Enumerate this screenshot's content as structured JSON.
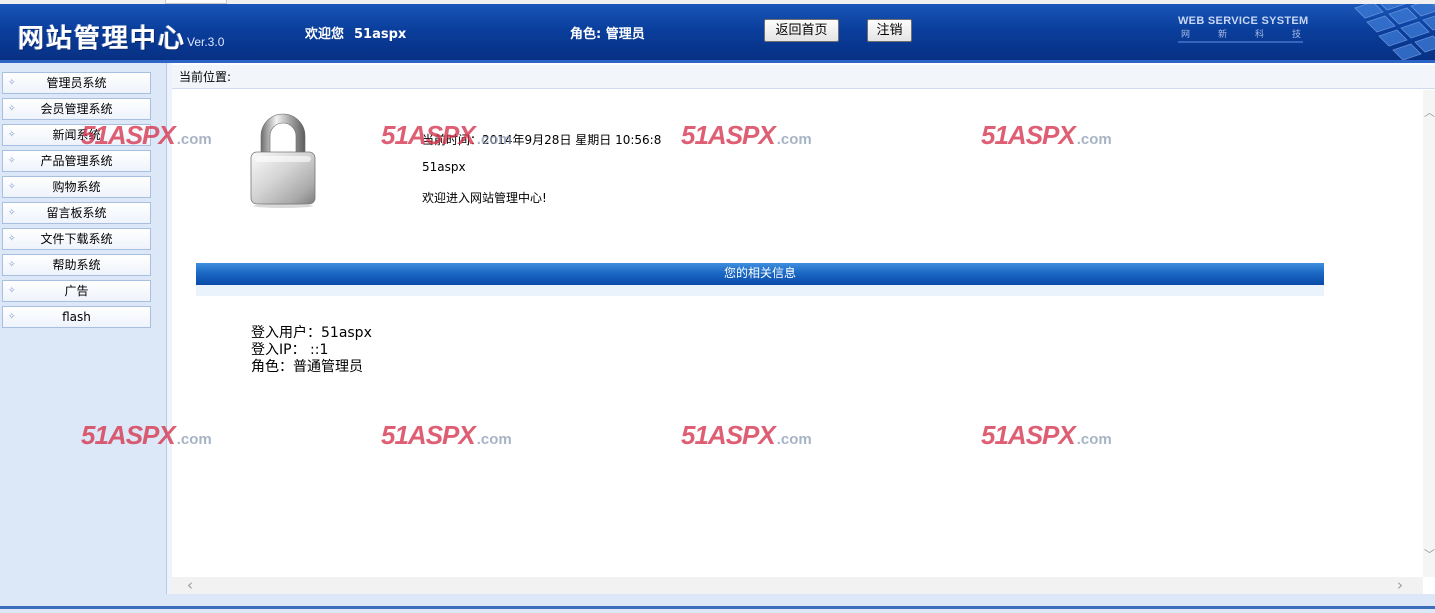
{
  "header": {
    "logo_text": "网站管理中心",
    "version": "Ver.3.0",
    "welcome_label": "欢迎您",
    "username": "51aspx",
    "role_label": "角色: 管理员",
    "home_button": "返回首页",
    "logout_button": "注销",
    "brand_en": "WEB SERVICE SYSTEM",
    "brand_cn": "网新科技"
  },
  "sidebar": {
    "items": [
      {
        "label": "管理员系统"
      },
      {
        "label": "会员管理系统"
      },
      {
        "label": "新闻系统"
      },
      {
        "label": "产品管理系统"
      },
      {
        "label": "购物系统"
      },
      {
        "label": "留言板系统"
      },
      {
        "label": "文件下载系统"
      },
      {
        "label": "帮助系统"
      },
      {
        "label": "广告"
      },
      {
        "label": "flash"
      }
    ]
  },
  "breadcrumb": {
    "label": "当前位置:"
  },
  "main": {
    "time_text": "当前时间：2014年9月28日 星期日 10:56:8",
    "user_text": "51aspx",
    "welcome_text": "欢迎进入网站管理中心!",
    "section_title": "您的相关信息",
    "account": {
      "user_line": "登入用户：51aspx",
      "ip_line": "登入IP：  ::1",
      "role_line": "角色：普通管理员"
    }
  },
  "watermark": {
    "big": "51ASPX",
    "domain": ".com"
  },
  "colors": {
    "header_blue": "#0a3e9c",
    "sidebar_bg": "#dce8f7",
    "section_bar": "#1b68c4",
    "watermark_red": "#d6334c"
  }
}
